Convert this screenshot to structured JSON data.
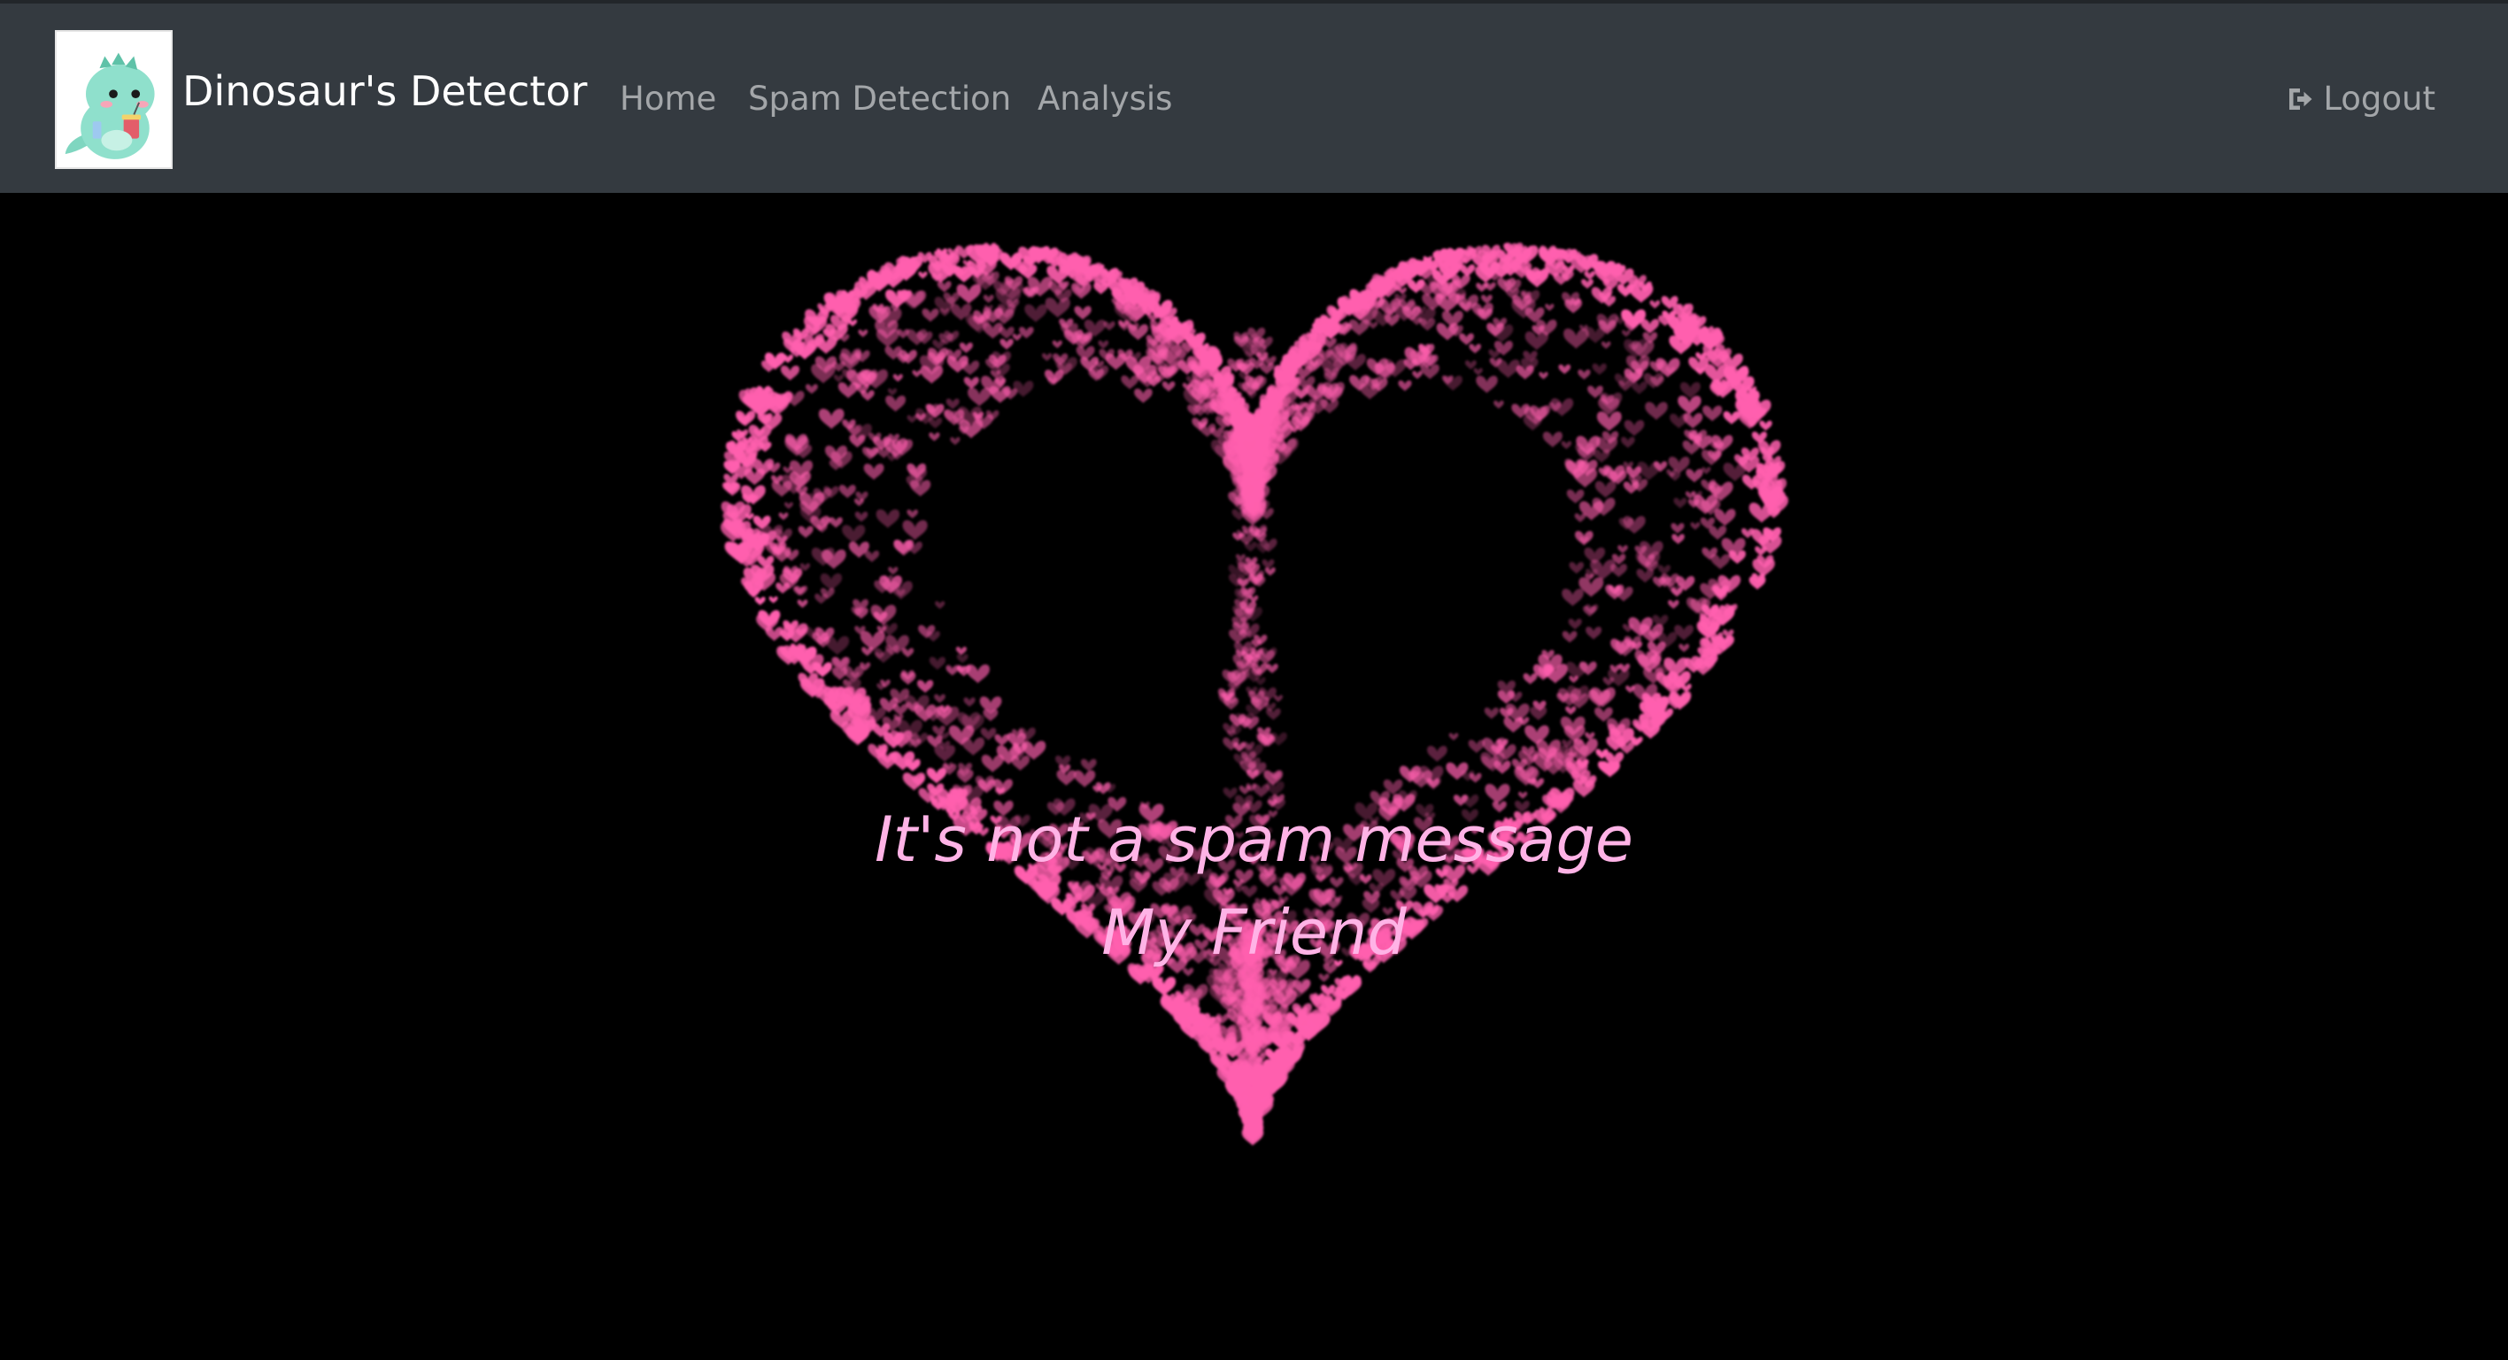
{
  "navbar": {
    "brand": "Dinosaur's Detector",
    "logo_icon": "dinosaur-mascot-logo",
    "links": [
      {
        "label": "Home"
      },
      {
        "label": "Spam Detection"
      },
      {
        "label": "Analysis"
      }
    ],
    "logout": {
      "label": "Logout",
      "icon": "sign-out-icon"
    }
  },
  "result": {
    "line1": "It's not a spam message",
    "line2": "My Friend",
    "text_color": "#ffb3e6",
    "heart_color": "#ff5fae"
  },
  "colors": {
    "navbar_bg": "#343a40",
    "page_bg": "#000000"
  }
}
